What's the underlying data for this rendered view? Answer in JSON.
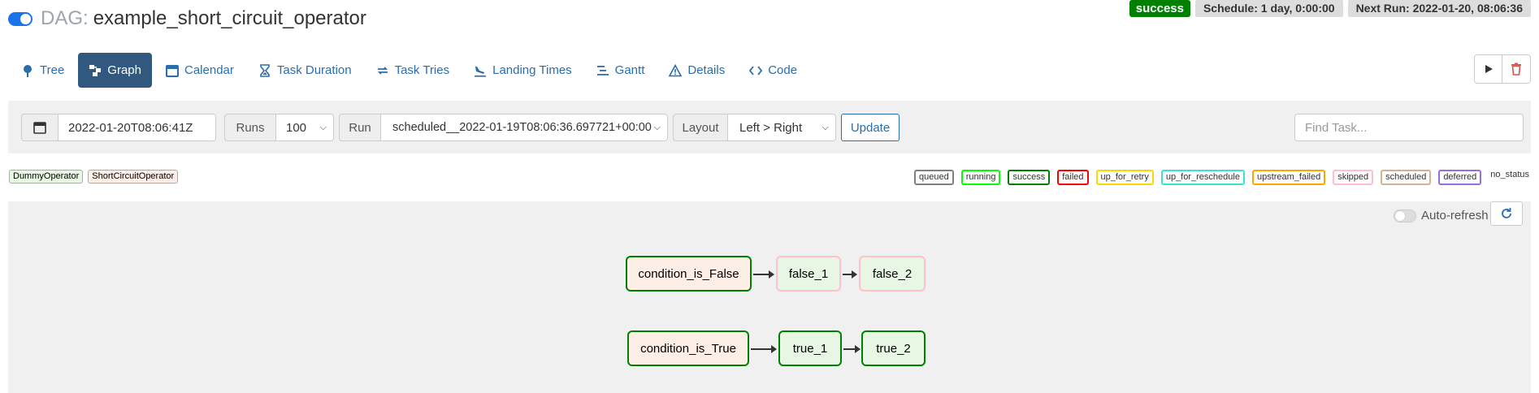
{
  "header": {
    "dag_prefix": "DAG:",
    "dag_id": "example_short_circuit_operator",
    "status": "success",
    "schedule": "Schedule: 1 day, 0:00:00",
    "next_run": "Next Run: 2022-01-20, 08:06:36"
  },
  "nav": {
    "tabs": [
      {
        "label": "Tree",
        "icon": "tree-icon"
      },
      {
        "label": "Graph",
        "icon": "graph-icon"
      },
      {
        "label": "Calendar",
        "icon": "calendar-icon"
      },
      {
        "label": "Task Duration",
        "icon": "hourglass-icon"
      },
      {
        "label": "Task Tries",
        "icon": "repeat-icon"
      },
      {
        "label": "Landing Times",
        "icon": "plane-landing-icon"
      },
      {
        "label": "Gantt",
        "icon": "gantt-icon"
      },
      {
        "label": "Details",
        "icon": "warning-triangle-icon"
      },
      {
        "label": "Code",
        "icon": "code-icon"
      }
    ],
    "active": "Graph"
  },
  "filter": {
    "date_value": "2022-01-20T08:06:41Z",
    "runs_label": "Runs",
    "runs_value": "100",
    "run_label": "Run",
    "run_value": "scheduled__2022-01-19T08:06:36.697721+00:00",
    "layout_label": "Layout",
    "layout_value": "Left > Right",
    "update_label": "Update",
    "find_task_placeholder": "Find Task..."
  },
  "operators": [
    {
      "label": "DummyOperator",
      "bg": "#e8f7e4"
    },
    {
      "label": "ShortCircuitOperator",
      "bg": "#fdeee6"
    }
  ],
  "statuses": [
    {
      "label": "queued",
      "color": "#808080"
    },
    {
      "label": "running",
      "color": "#00ff00"
    },
    {
      "label": "success",
      "color": "#008000"
    },
    {
      "label": "failed",
      "color": "#ff0000"
    },
    {
      "label": "up_for_retry",
      "color": "#ffd700"
    },
    {
      "label": "up_for_reschedule",
      "color": "#40e0d0"
    },
    {
      "label": "upstream_failed",
      "color": "#ffa500"
    },
    {
      "label": "skipped",
      "color": "#ffc0cb"
    },
    {
      "label": "scheduled",
      "color": "#d2b48c"
    },
    {
      "label": "deferred",
      "color": "#9370db"
    },
    {
      "label": "no_status",
      "color": ""
    }
  ],
  "graph": {
    "autorefresh_label": "Auto-refresh",
    "nodes": {
      "condition_is_false": "condition_is_False",
      "false_1": "false_1",
      "false_2": "false_2",
      "condition_is_true": "condition_is_True",
      "true_1": "true_1",
      "true_2": "true_2"
    }
  },
  "colors": {
    "accent": "#2a6dad",
    "active_tab": "#31597f",
    "success": "#008000",
    "skipped": "#ffc0cb",
    "dummy_fill": "#e8f7e4",
    "short_circuit_fill": "#fdeee6"
  }
}
